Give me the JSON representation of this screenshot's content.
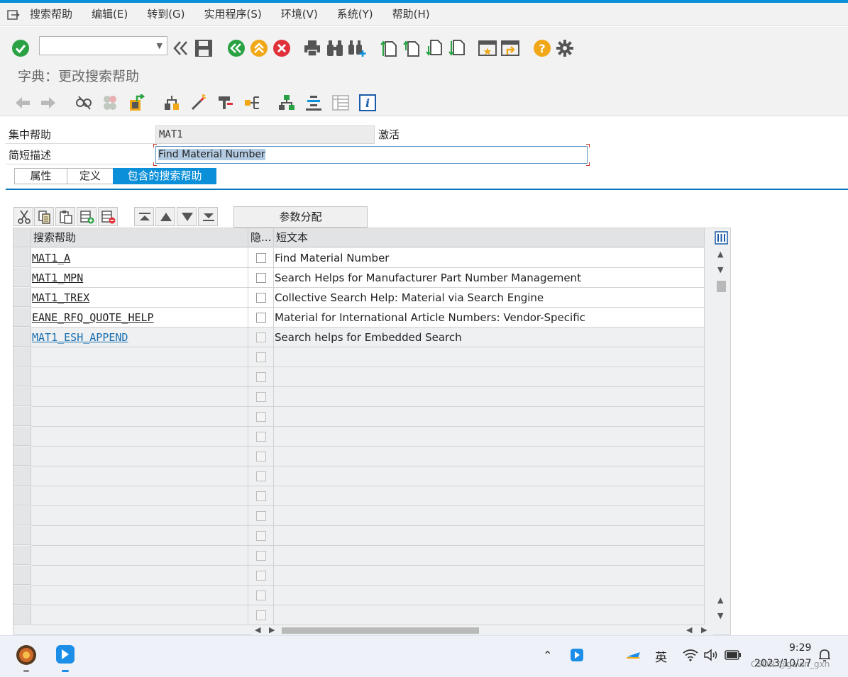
{
  "menu": [
    "搜索帮助",
    "编辑(E)",
    "转到(G)",
    "实用程序(S)",
    "环境(V)",
    "系统(Y)",
    "帮助(H)"
  ],
  "command_field": {
    "value": ""
  },
  "title": "字典：更改搜索帮助",
  "header": {
    "collective_label": "集中帮助",
    "collective_value": "MAT1",
    "status": "激活",
    "desc_label": "简短描述",
    "desc_value": "Find Material Number"
  },
  "tabs": [
    "属性",
    "定义",
    "包含的搜索帮助"
  ],
  "active_tab": 2,
  "param_button": "参数分配",
  "table": {
    "columns": [
      "搜索帮助",
      "隐...",
      "短文本"
    ],
    "rows": [
      {
        "name": "MAT1_A",
        "hidden": false,
        "text": "Find Material Number"
      },
      {
        "name": "MAT1_MPN",
        "hidden": false,
        "text": "Search Helps for Manufacturer Part Number Management"
      },
      {
        "name": "MAT1_TREX",
        "hidden": false,
        "text": "Collective Search Help: Material via Search Engine"
      },
      {
        "name": "EANE_RFQ_QUOTE_HELP",
        "hidden": false,
        "text": "Material for International Article Numbers: Vendor-Specific"
      },
      {
        "name": "MAT1_ESH_APPEND",
        "hidden": false,
        "text": "Search helps for Embedded Search"
      }
    ],
    "empty_rows": 14
  },
  "taskbar": {
    "lang": "英",
    "time": "9:29",
    "date": "2023/10/27",
    "watermark": "CSDN @gavin_gxh"
  },
  "colors": {
    "accent": "#0a8fd8",
    "link": "#1a6fb0",
    "ok_green": "#2aa244",
    "cancel_red": "#e0313b",
    "help_orange": "#f0a818"
  }
}
